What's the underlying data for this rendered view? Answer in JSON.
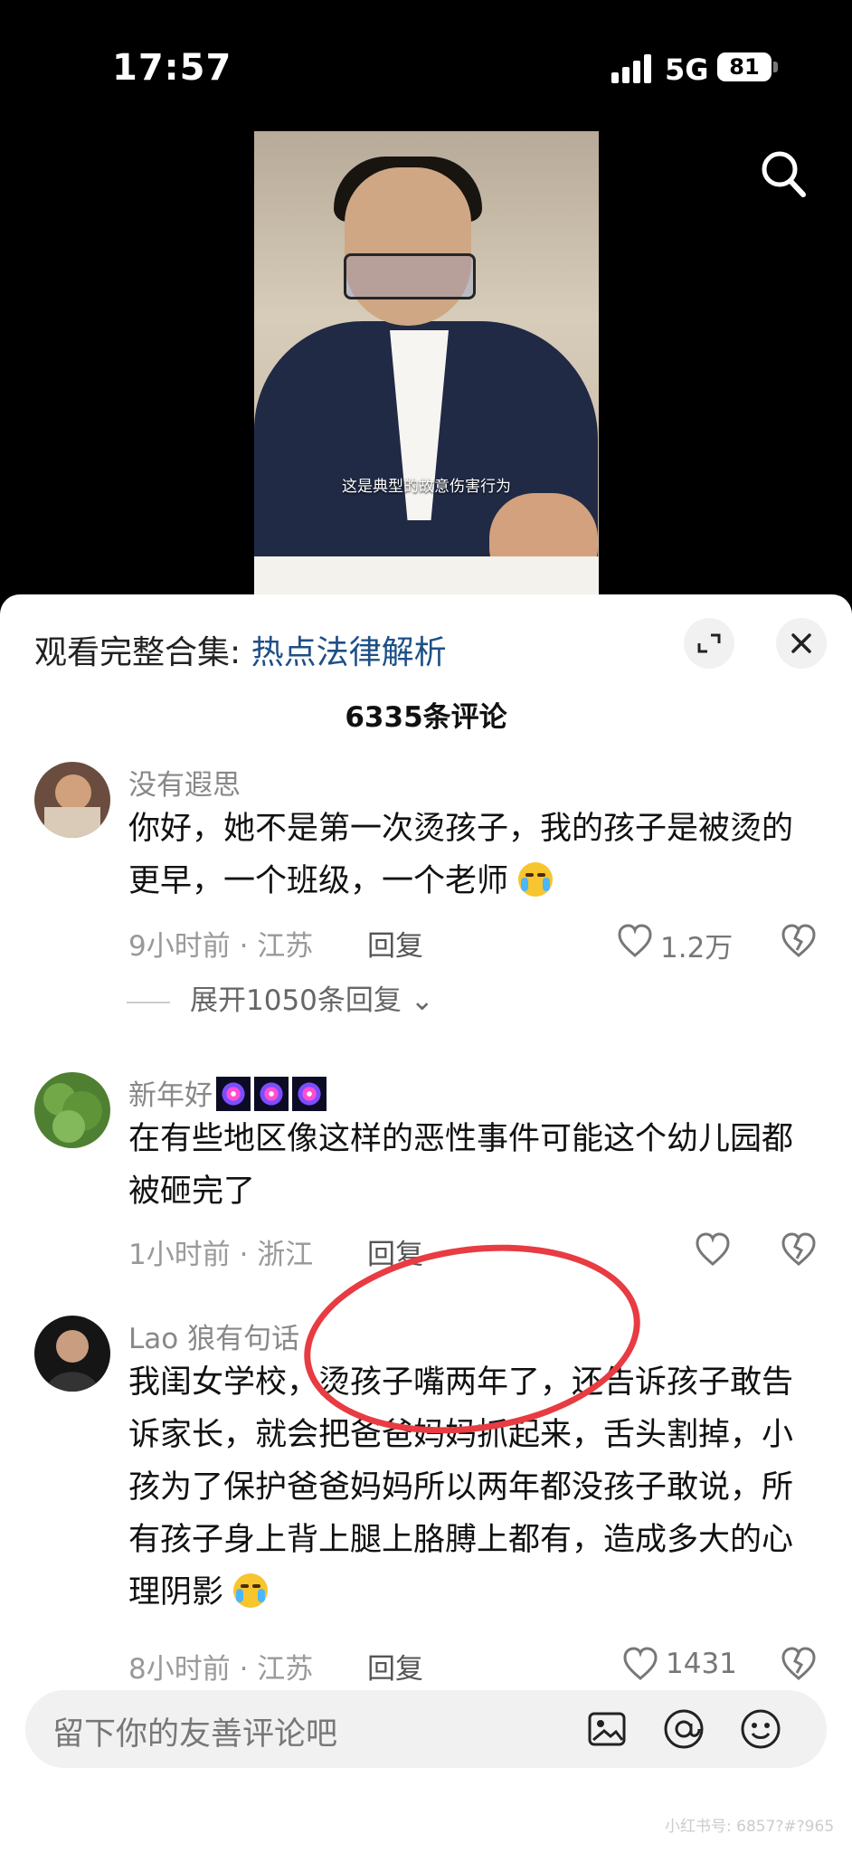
{
  "status": {
    "time": "17:57",
    "network": "5G",
    "battery": "81"
  },
  "video": {
    "subtitle": "这是典型的故意伤害行为"
  },
  "header": {
    "collection_prefix": "观看完整合集: ",
    "collection_title": "热点法律解析",
    "comment_count": "6335条评论"
  },
  "comments": [
    {
      "name": "没有遐思",
      "text": "你好，她不是第一次烫孩子，我的孩子是被烫的更早，一个班级，一个老师",
      "meta": "9小时前 · 江苏",
      "reply": "回复",
      "likes": "1.2万",
      "expand": "展开1050条回复",
      "emoji": "loudly-crying-face"
    },
    {
      "name": "新年好",
      "text": "在有些地区像这样的恶性事件可能这个幼儿园都被砸完了",
      "meta": "1小时前 · 浙江",
      "reply": "回复",
      "likes": "",
      "emoji": "fireworks-icons"
    },
    {
      "name": "Lao 狼有句话",
      "text": "我闺女学校，烫孩子嘴两年了，还告诉孩子敢告诉家长，就会把爸爸妈妈抓起来，舌头割掉，小孩为了保护爸爸妈妈所以两年都没孩子敢说，所有孩子身上背上腿上胳膊上都有，造成多大的心理阴影",
      "meta": "8小时前 · 江苏",
      "reply": "回复",
      "likes": "1431",
      "emoji": "loudly-crying-face"
    }
  ],
  "input": {
    "placeholder": "留下你的友善评论吧",
    "icons": [
      "image-icon",
      "at-icon",
      "emoji-icon"
    ]
  },
  "watermark": "小红书号: 6857?#?965",
  "colors": {
    "link": "#1d4f86",
    "annotation": "#e83b42"
  }
}
